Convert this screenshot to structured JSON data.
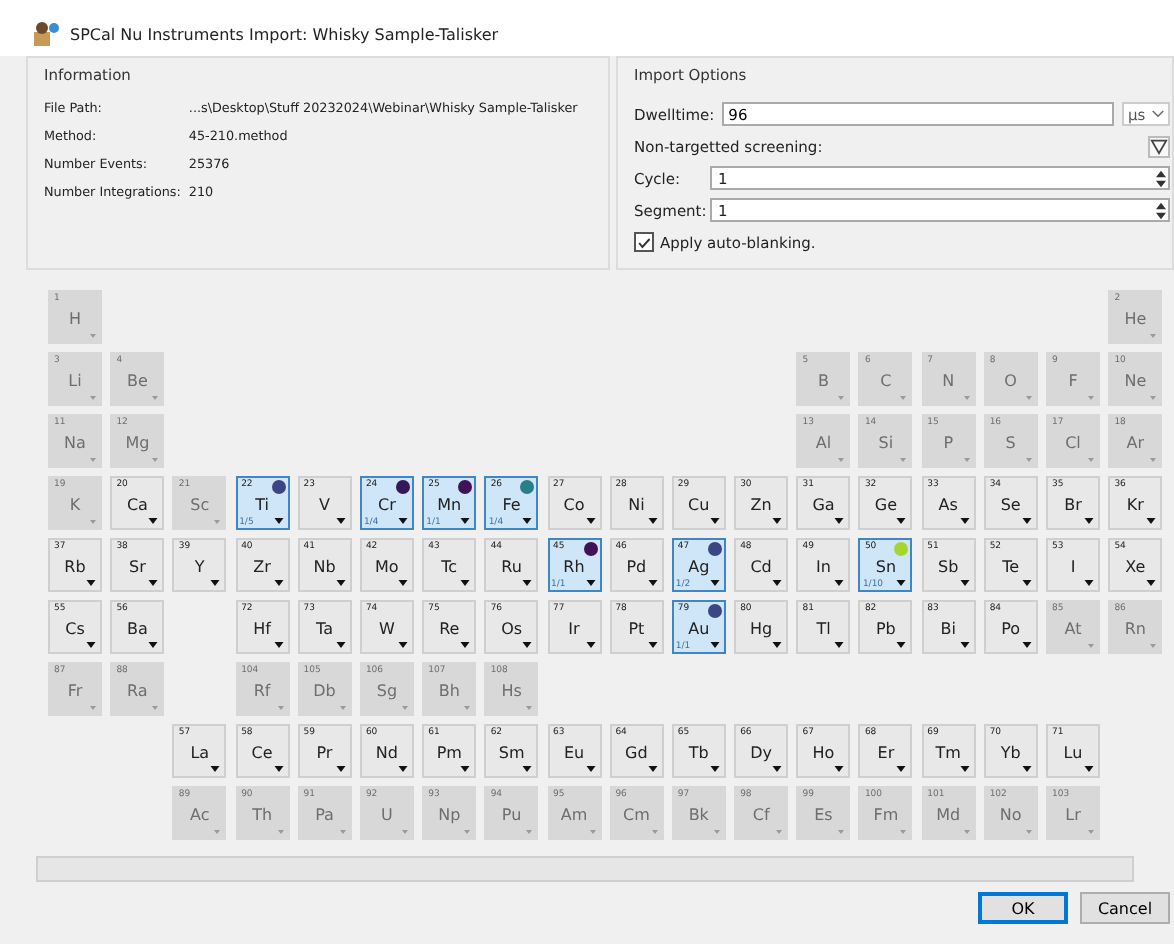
{
  "window": {
    "title": "SPCal Nu Instruments Import: Whisky Sample-Talisker"
  },
  "information": {
    "title": "Information",
    "fields": [
      {
        "label": "File Path:",
        "value": "...s\\Desktop\\Stuff 20232024\\Webinar\\Whisky Sample-Talisker"
      },
      {
        "label": "Method:",
        "value": "45-210.method"
      },
      {
        "label": "Number Events:",
        "value": "25376"
      },
      {
        "label": "Number Integrations:",
        "value": "210"
      }
    ]
  },
  "import_options": {
    "title": "Import Options",
    "dwelltime": {
      "label": "Dwelltime:",
      "value": "96",
      "unit": "µs"
    },
    "screening": {
      "label": "Non-targetted screening:"
    },
    "cycle": {
      "label": "Cycle:",
      "value": "1"
    },
    "segment": {
      "label": "Segment:",
      "value": "1"
    },
    "auto_blanking": {
      "label": "Apply auto-blanking.",
      "checked": true
    }
  },
  "elements": [
    {
      "number": "1",
      "symbol": "H",
      "enabled": false,
      "selected": false
    },
    {
      "number": "2",
      "symbol": "He",
      "enabled": false,
      "selected": false
    },
    {
      "number": "3",
      "symbol": "Li",
      "enabled": false,
      "selected": false
    },
    {
      "number": "4",
      "symbol": "Be",
      "enabled": false,
      "selected": false
    },
    {
      "number": "5",
      "symbol": "B",
      "enabled": false,
      "selected": false
    },
    {
      "number": "6",
      "symbol": "C",
      "enabled": false,
      "selected": false
    },
    {
      "number": "7",
      "symbol": "N",
      "enabled": false,
      "selected": false
    },
    {
      "number": "8",
      "symbol": "O",
      "enabled": false,
      "selected": false
    },
    {
      "number": "9",
      "symbol": "F",
      "enabled": false,
      "selected": false
    },
    {
      "number": "10",
      "symbol": "Ne",
      "enabled": false,
      "selected": false
    },
    {
      "number": "11",
      "symbol": "Na",
      "enabled": false,
      "selected": false
    },
    {
      "number": "12",
      "symbol": "Mg",
      "enabled": false,
      "selected": false
    },
    {
      "number": "13",
      "symbol": "Al",
      "enabled": false,
      "selected": false
    },
    {
      "number": "14",
      "symbol": "Si",
      "enabled": false,
      "selected": false
    },
    {
      "number": "15",
      "symbol": "P",
      "enabled": false,
      "selected": false
    },
    {
      "number": "16",
      "symbol": "S",
      "enabled": false,
      "selected": false
    },
    {
      "number": "17",
      "symbol": "Cl",
      "enabled": false,
      "selected": false
    },
    {
      "number": "18",
      "symbol": "Ar",
      "enabled": false,
      "selected": false
    },
    {
      "number": "19",
      "symbol": "K",
      "enabled": false,
      "selected": false
    },
    {
      "number": "20",
      "symbol": "Ca",
      "enabled": true,
      "selected": false
    },
    {
      "number": "21",
      "symbol": "Sc",
      "enabled": false,
      "selected": false
    },
    {
      "number": "22",
      "symbol": "Ti",
      "enabled": true,
      "selected": true,
      "isotopes": "1/5",
      "color": "#3b4685"
    },
    {
      "number": "23",
      "symbol": "V",
      "enabled": true,
      "selected": false
    },
    {
      "number": "24",
      "symbol": "Cr",
      "enabled": true,
      "selected": true,
      "isotopes": "1/4",
      "color": "#35185a"
    },
    {
      "number": "25",
      "symbol": "Mn",
      "enabled": true,
      "selected": true,
      "isotopes": "1/1",
      "color": "#421257"
    },
    {
      "number": "26",
      "symbol": "Fe",
      "enabled": true,
      "selected": true,
      "isotopes": "1/4",
      "color": "#2a7f86"
    },
    {
      "number": "27",
      "symbol": "Co",
      "enabled": true,
      "selected": false
    },
    {
      "number": "28",
      "symbol": "Ni",
      "enabled": true,
      "selected": false
    },
    {
      "number": "29",
      "symbol": "Cu",
      "enabled": true,
      "selected": false
    },
    {
      "number": "30",
      "symbol": "Zn",
      "enabled": true,
      "selected": false
    },
    {
      "number": "31",
      "symbol": "Ga",
      "enabled": true,
      "selected": false
    },
    {
      "number": "32",
      "symbol": "Ge",
      "enabled": true,
      "selected": false
    },
    {
      "number": "33",
      "symbol": "As",
      "enabled": true,
      "selected": false
    },
    {
      "number": "34",
      "symbol": "Se",
      "enabled": true,
      "selected": false
    },
    {
      "number": "35",
      "symbol": "Br",
      "enabled": true,
      "selected": false
    },
    {
      "number": "36",
      "symbol": "Kr",
      "enabled": true,
      "selected": false
    },
    {
      "number": "37",
      "symbol": "Rb",
      "enabled": true,
      "selected": false
    },
    {
      "number": "38",
      "symbol": "Sr",
      "enabled": true,
      "selected": false
    },
    {
      "number": "39",
      "symbol": "Y",
      "enabled": true,
      "selected": false
    },
    {
      "number": "40",
      "symbol": "Zr",
      "enabled": true,
      "selected": false
    },
    {
      "number": "41",
      "symbol": "Nb",
      "enabled": true,
      "selected": false
    },
    {
      "number": "42",
      "symbol": "Mo",
      "enabled": true,
      "selected": false
    },
    {
      "number": "43",
      "symbol": "Tc",
      "enabled": true,
      "selected": false
    },
    {
      "number": "44",
      "symbol": "Ru",
      "enabled": true,
      "selected": false
    },
    {
      "number": "45",
      "symbol": "Rh",
      "enabled": true,
      "selected": true,
      "isotopes": "1/1",
      "color": "#421257"
    },
    {
      "number": "46",
      "symbol": "Pd",
      "enabled": true,
      "selected": false
    },
    {
      "number": "47",
      "symbol": "Ag",
      "enabled": true,
      "selected": true,
      "isotopes": "1/2",
      "color": "#3b4685"
    },
    {
      "number": "48",
      "symbol": "Cd",
      "enabled": true,
      "selected": false
    },
    {
      "number": "49",
      "symbol": "In",
      "enabled": true,
      "selected": false
    },
    {
      "number": "50",
      "symbol": "Sn",
      "enabled": true,
      "selected": true,
      "isotopes": "1/10",
      "color": "#a6d62e"
    },
    {
      "number": "51",
      "symbol": "Sb",
      "enabled": true,
      "selected": false
    },
    {
      "number": "52",
      "symbol": "Te",
      "enabled": true,
      "selected": false
    },
    {
      "number": "53",
      "symbol": "I",
      "enabled": true,
      "selected": false
    },
    {
      "number": "54",
      "symbol": "Xe",
      "enabled": true,
      "selected": false
    },
    {
      "number": "55",
      "symbol": "Cs",
      "enabled": true,
      "selected": false
    },
    {
      "number": "56",
      "symbol": "Ba",
      "enabled": true,
      "selected": false
    },
    {
      "number": "57",
      "symbol": "La",
      "enabled": true,
      "selected": false
    },
    {
      "number": "58",
      "symbol": "Ce",
      "enabled": true,
      "selected": false
    },
    {
      "number": "59",
      "symbol": "Pr",
      "enabled": true,
      "selected": false
    },
    {
      "number": "60",
      "symbol": "Nd",
      "enabled": true,
      "selected": false
    },
    {
      "number": "61",
      "symbol": "Pm",
      "enabled": true,
      "selected": false
    },
    {
      "number": "62",
      "symbol": "Sm",
      "enabled": true,
      "selected": false
    },
    {
      "number": "63",
      "symbol": "Eu",
      "enabled": true,
      "selected": false
    },
    {
      "number": "64",
      "symbol": "Gd",
      "enabled": true,
      "selected": false
    },
    {
      "number": "65",
      "symbol": "Tb",
      "enabled": true,
      "selected": false
    },
    {
      "number": "66",
      "symbol": "Dy",
      "enabled": true,
      "selected": false
    },
    {
      "number": "67",
      "symbol": "Ho",
      "enabled": true,
      "selected": false
    },
    {
      "number": "68",
      "symbol": "Er",
      "enabled": true,
      "selected": false
    },
    {
      "number": "69",
      "symbol": "Tm",
      "enabled": true,
      "selected": false
    },
    {
      "number": "70",
      "symbol": "Yb",
      "enabled": true,
      "selected": false
    },
    {
      "number": "71",
      "symbol": "Lu",
      "enabled": true,
      "selected": false
    },
    {
      "number": "72",
      "symbol": "Hf",
      "enabled": true,
      "selected": false
    },
    {
      "number": "73",
      "symbol": "Ta",
      "enabled": true,
      "selected": false
    },
    {
      "number": "74",
      "symbol": "W",
      "enabled": true,
      "selected": false
    },
    {
      "number": "75",
      "symbol": "Re",
      "enabled": true,
      "selected": false
    },
    {
      "number": "76",
      "symbol": "Os",
      "enabled": true,
      "selected": false
    },
    {
      "number": "77",
      "symbol": "Ir",
      "enabled": true,
      "selected": false
    },
    {
      "number": "78",
      "symbol": "Pt",
      "enabled": true,
      "selected": false
    },
    {
      "number": "79",
      "symbol": "Au",
      "enabled": true,
      "selected": true,
      "isotopes": "1/1",
      "color": "#3b4685"
    },
    {
      "number": "80",
      "symbol": "Hg",
      "enabled": true,
      "selected": false
    },
    {
      "number": "81",
      "symbol": "Tl",
      "enabled": true,
      "selected": false
    },
    {
      "number": "82",
      "symbol": "Pb",
      "enabled": true,
      "selected": false
    },
    {
      "number": "83",
      "symbol": "Bi",
      "enabled": true,
      "selected": false
    },
    {
      "number": "84",
      "symbol": "Po",
      "enabled": true,
      "selected": false
    },
    {
      "number": "85",
      "symbol": "At",
      "enabled": false,
      "selected": false
    },
    {
      "number": "86",
      "symbol": "Rn",
      "enabled": false,
      "selected": false
    },
    {
      "number": "87",
      "symbol": "Fr",
      "enabled": false,
      "selected": false
    },
    {
      "number": "88",
      "symbol": "Ra",
      "enabled": false,
      "selected": false
    },
    {
      "number": "89",
      "symbol": "Ac",
      "enabled": false,
      "selected": false
    },
    {
      "number": "90",
      "symbol": "Th",
      "enabled": false,
      "selected": false
    },
    {
      "number": "91",
      "symbol": "Pa",
      "enabled": false,
      "selected": false
    },
    {
      "number": "92",
      "symbol": "U",
      "enabled": false,
      "selected": false
    },
    {
      "number": "93",
      "symbol": "Np",
      "enabled": false,
      "selected": false
    },
    {
      "number": "94",
      "symbol": "Pu",
      "enabled": false,
      "selected": false
    },
    {
      "number": "95",
      "symbol": "Am",
      "enabled": false,
      "selected": false
    },
    {
      "number": "96",
      "symbol": "Cm",
      "enabled": false,
      "selected": false
    },
    {
      "number": "97",
      "symbol": "Bk",
      "enabled": false,
      "selected": false
    },
    {
      "number": "98",
      "symbol": "Cf",
      "enabled": false,
      "selected": false
    },
    {
      "number": "99",
      "symbol": "Es",
      "enabled": false,
      "selected": false
    },
    {
      "number": "100",
      "symbol": "Fm",
      "enabled": false,
      "selected": false
    },
    {
      "number": "101",
      "symbol": "Md",
      "enabled": false,
      "selected": false
    },
    {
      "number": "102",
      "symbol": "No",
      "enabled": false,
      "selected": false
    },
    {
      "number": "103",
      "symbol": "Lr",
      "enabled": false,
      "selected": false
    },
    {
      "number": "104",
      "symbol": "Rf",
      "enabled": false,
      "selected": false
    },
    {
      "number": "105",
      "symbol": "Db",
      "enabled": false,
      "selected": false
    },
    {
      "number": "106",
      "symbol": "Sg",
      "enabled": false,
      "selected": false
    },
    {
      "number": "107",
      "symbol": "Bh",
      "enabled": false,
      "selected": false
    },
    {
      "number": "108",
      "symbol": "Hs",
      "enabled": false,
      "selected": false
    }
  ],
  "progress": {
    "level": 0
  },
  "buttons": [
    "OK",
    "Cancel"
  ]
}
